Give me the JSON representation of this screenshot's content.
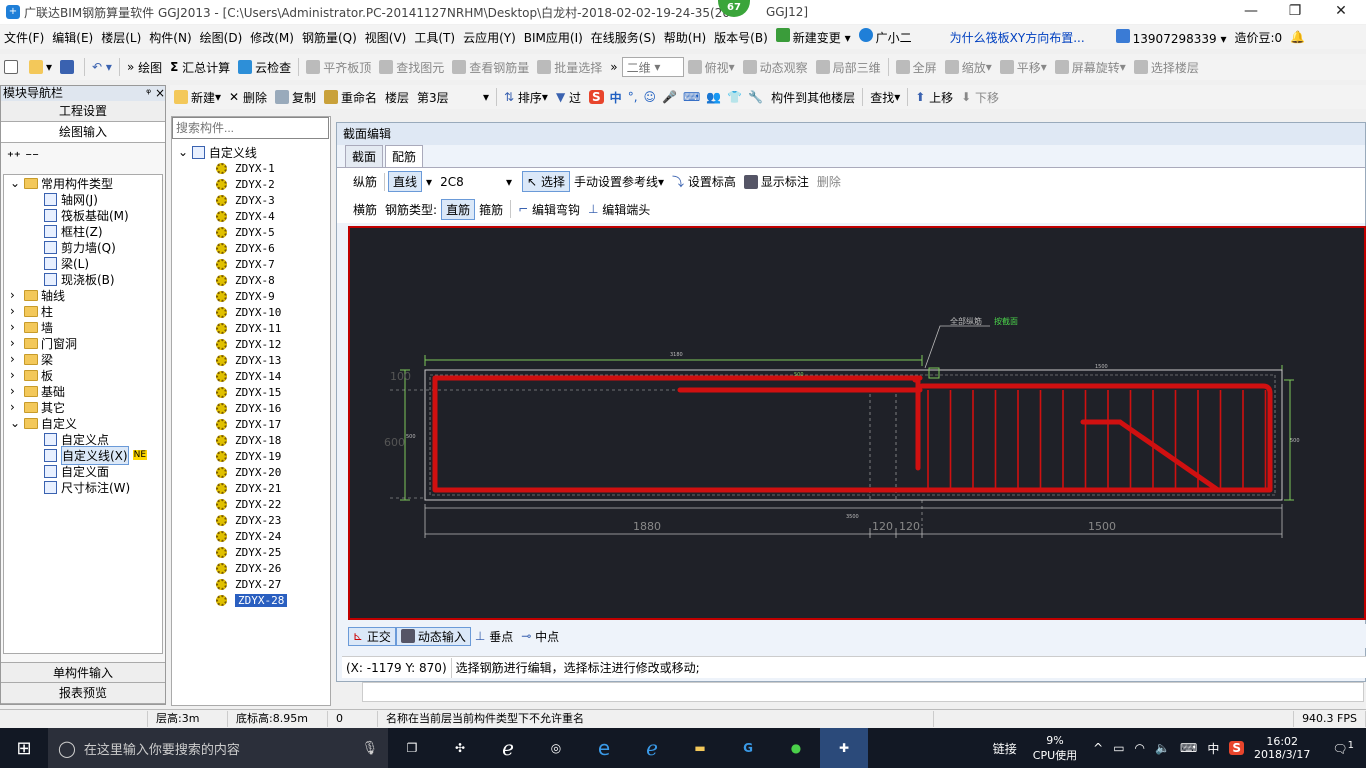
{
  "window": {
    "title": "广联达BIM钢筋算量软件 GGJ2013 - [C:\\Users\\Administrator.PC-20141127NRHM\\Desktop\\白龙村-2018-02-02-19-24-35(20",
    "title_tail": "GGJ12]",
    "badge": "67"
  },
  "menu": {
    "items": [
      "文件(F)",
      "编辑(E)",
      "楼层(L)",
      "构件(N)",
      "绘图(D)",
      "修改(M)",
      "钢筋量(Q)",
      "视图(V)",
      "工具(T)",
      "云应用(Y)",
      "BIM应用(I)",
      "在线服务(S)",
      "帮助(H)",
      "版本号(B)"
    ],
    "new_change": "新建变更",
    "guangxiaoer": "广小二",
    "question": "为什么筏板XY方向布置...",
    "phone": "13907298339",
    "price": "造价豆:0"
  },
  "toolbar1": {
    "draw": "绘图",
    "sum": "汇总计算",
    "cloud_check": "云检查",
    "align_top": "平齐板顶",
    "find_element": "查找图元",
    "view_rebar": "查看钢筋量",
    "batch_select": "批量选择",
    "view_mode": "二维",
    "top_view": "俯视",
    "dynamic_view": "动态观察",
    "local_3d": "局部三维",
    "fullscreen": "全屏",
    "zoom": "缩放",
    "pan": "平移",
    "rotate": "屏幕旋转",
    "select_floor": "选择楼层"
  },
  "toolbar2": {
    "new": "新建",
    "delete": "删除",
    "copy": "复制",
    "rename": "重命名",
    "floor_label": "楼层",
    "floor_value": "第3层",
    "sort": "排序",
    "filter": "过",
    "copy_to_floor": "构件到其他楼层",
    "find": "查找",
    "move_up": "上移",
    "move_down": "下移"
  },
  "nav": {
    "header": "模块导航栏",
    "pin": "ᵠ ×",
    "project_settings": "工程设置",
    "drawing_input": "绘图输入",
    "tree": [
      {
        "label": "常用构件类型",
        "level": 0,
        "type": "folder",
        "open": true
      },
      {
        "label": "轴网(J)",
        "level": 2,
        "type": "item"
      },
      {
        "label": "筏板基础(M)",
        "level": 2,
        "type": "item"
      },
      {
        "label": "框柱(Z)",
        "level": 2,
        "type": "item"
      },
      {
        "label": "剪力墙(Q)",
        "level": 2,
        "type": "item"
      },
      {
        "label": "梁(L)",
        "level": 2,
        "type": "item"
      },
      {
        "label": "现浇板(B)",
        "level": 2,
        "type": "item"
      },
      {
        "label": "轴线",
        "level": 0,
        "type": "folder"
      },
      {
        "label": "柱",
        "level": 0,
        "type": "folder"
      },
      {
        "label": "墙",
        "level": 0,
        "type": "folder"
      },
      {
        "label": "门窗洞",
        "level": 0,
        "type": "folder"
      },
      {
        "label": "梁",
        "level": 0,
        "type": "folder"
      },
      {
        "label": "板",
        "level": 0,
        "type": "folder"
      },
      {
        "label": "基础",
        "level": 0,
        "type": "folder"
      },
      {
        "label": "其它",
        "level": 0,
        "type": "folder"
      },
      {
        "label": "自定义",
        "level": 0,
        "type": "folder",
        "open": true
      },
      {
        "label": "自定义点",
        "level": 2,
        "type": "item"
      },
      {
        "label": "自定义线(X)",
        "level": 2,
        "type": "item",
        "selected": true,
        "tag": "NE"
      },
      {
        "label": "自定义面",
        "level": 2,
        "type": "item"
      },
      {
        "label": "尺寸标注(W)",
        "level": 2,
        "type": "item"
      }
    ],
    "single_input": "单构件输入",
    "report_preview": "报表预览"
  },
  "parts": {
    "search_placeholder": "搜索构件...",
    "root": "自定义线",
    "items": [
      "ZDYX-1",
      "ZDYX-2",
      "ZDYX-3",
      "ZDYX-4",
      "ZDYX-5",
      "ZDYX-6",
      "ZDYX-7",
      "ZDYX-8",
      "ZDYX-9",
      "ZDYX-10",
      "ZDYX-11",
      "ZDYX-12",
      "ZDYX-13",
      "ZDYX-14",
      "ZDYX-15",
      "ZDYX-16",
      "ZDYX-17",
      "ZDYX-18",
      "ZDYX-19",
      "ZDYX-20",
      "ZDYX-21",
      "ZDYX-22",
      "ZDYX-23",
      "ZDYX-24",
      "ZDYX-25",
      "ZDYX-26",
      "ZDYX-27",
      "ZDYX-28"
    ],
    "selected": "ZDYX-28"
  },
  "editor": {
    "title": "截面编辑",
    "tabs": [
      "截面",
      "配筋"
    ],
    "active_tab": "配筋",
    "row1": {
      "longitudinal": "纵筋",
      "line": "直线",
      "spec": "2C8",
      "select": "选择",
      "manual_ref": "手动设置参考线",
      "set_elev": "设置标高",
      "show_label": "显示标注",
      "delete": "删除"
    },
    "row2": {
      "transverse": "横筋",
      "rebar_type_label": "钢筋类型:",
      "straight": "直筋",
      "stirrup": "箍筋",
      "edit_hook": "编辑弯钩",
      "edit_end": "编辑端头"
    },
    "canvas": {
      "annot_all": "全部纵筋",
      "annot_by_section": "按截面",
      "dim_top_left": "3180",
      "dim_top_right": "1500",
      "dim_bottom": [
        "1880",
        "120",
        "120",
        "1500"
      ],
      "side_600": "600",
      "side_100": "100",
      "dim_total": "3500",
      "small_dims": [
        "500",
        "500",
        "500"
      ]
    },
    "snap": {
      "ortho": "正交",
      "dynamic": "动态输入",
      "perp": "垂点",
      "mid": "中点"
    },
    "coords": "(X: -1179 Y: 870)",
    "hint": "选择钢筋进行编辑，选择标注进行修改或移动;"
  },
  "statusbar": {
    "floor_height": "层高:3m",
    "base_elev": "底标高:8.95m",
    "zero": "0",
    "message": "名称在当前层当前构件类型下不允许重名",
    "fps": "940.3 FPS"
  },
  "taskbar": {
    "search_placeholder": "在这里输入你要搜索的内容",
    "network": "链接",
    "cpu_pct": "9%",
    "cpu_label": "CPU使用",
    "ime": "中",
    "time": "16:02",
    "date": "2018/3/17",
    "notif": "1"
  }
}
